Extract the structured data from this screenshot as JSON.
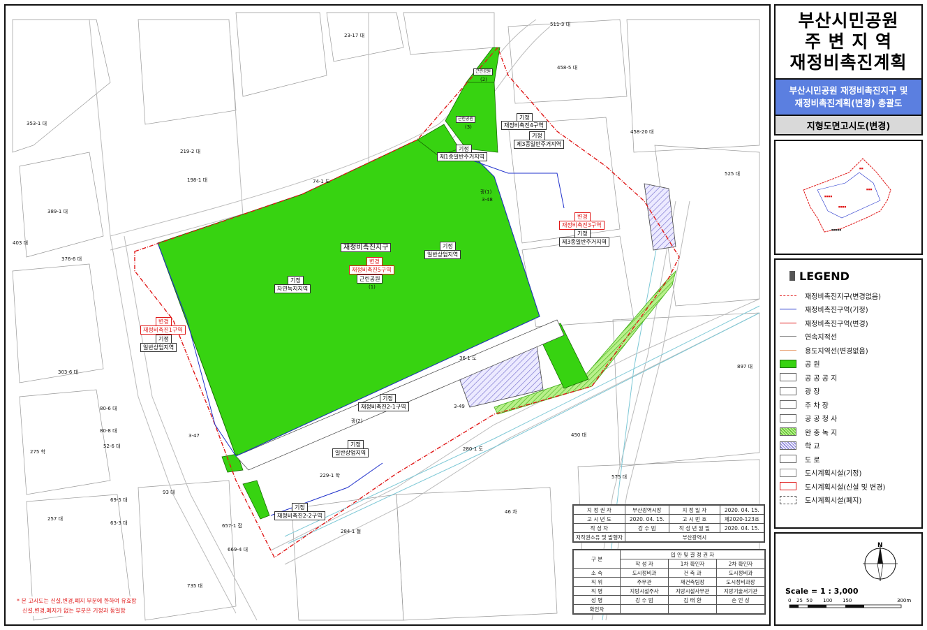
{
  "title": {
    "line1": "부산시민공원",
    "line2": "주 변 지 역",
    "line3": "재정비촉진계획"
  },
  "subtitle": {
    "line1": "부산시민공원 재정비촉진지구 및",
    "line2": "재정비촉진계획(변경) 총괄도"
  },
  "map_name": "지형도면고시도(변경)",
  "legend": {
    "title": "LEGEND",
    "items": [
      {
        "label": "재정비촉진지구(변경없음)",
        "sym": "red-dash"
      },
      {
        "label": "재정비촉진구역(기정)",
        "sym": "blue-line"
      },
      {
        "label": "재정비촉진구역(변경)",
        "sym": "red-line"
      },
      {
        "label": "연속지적선",
        "sym": "gray-line"
      },
      {
        "label": "용도지역선(변경없음)",
        "sym": "orange-line"
      },
      {
        "label": "공 원",
        "sym": "green-fill"
      },
      {
        "label": "공 공 공 지",
        "sym": "box"
      },
      {
        "label": "광 장",
        "sym": "box"
      },
      {
        "label": "주 차 장",
        "sym": "box"
      },
      {
        "label": "공 공 청 사",
        "sym": "box"
      },
      {
        "label": "완 충 녹 지",
        "sym": "hatch-green"
      },
      {
        "label": "학 교",
        "sym": "hatch-blue"
      },
      {
        "label": "도 로",
        "sym": "empty"
      },
      {
        "label": "도시계획시설(기정)",
        "sym": "gray-frame"
      },
      {
        "label": "도시계획시설(신설 및 변경)",
        "sym": "red-frame"
      },
      {
        "label": "도시계획시설(폐지)",
        "sym": "dash-frame"
      }
    ]
  },
  "scale": {
    "label": "Scale = 1 : 3,000",
    "ticks": [
      "0",
      "25",
      "50",
      "100",
      "150",
      "300m"
    ],
    "north": "N"
  },
  "map_labels": {
    "district": "재정비촉진지구",
    "change": "변경",
    "zone5": "재정비촉진5구역",
    "park": "근린공원",
    "park_no": "(1)",
    "existing": "기정",
    "natural_green": "자연녹지지역",
    "general_commercial": "일반상업지역",
    "zone4": "재정비촉진4구역",
    "residential3": "제3종일반주거지역",
    "residential1": "제1종일반주거지역",
    "zone3": "재정비촉진3구역",
    "zone1": "재정비촉진1구역",
    "zone2_1": "재정비촉진2-1구역",
    "zone2_2": "재정비촉진2-2구역",
    "park_small": "근린공원",
    "park2": "(2)",
    "park3": "(3)",
    "road1": "광(1)",
    "road2": "광(2)",
    "road3": "3-48",
    "road4": "3-49",
    "road5": "3-47",
    "parcels": [
      "23-17 대",
      "511-3 대",
      "458-5 대",
      "458-20 대",
      "525 대",
      "353-1 대",
      "219-2 대",
      "198-1 대",
      "74-1 도",
      "389-1 대",
      "403 대",
      "376-6 대",
      "303-6 대",
      "80-6 대",
      "80-8 대",
      "52-6 대",
      "275 학",
      "93 대",
      "69-5 대",
      "63-3 대",
      "257 대",
      "735 대",
      "669-4 대",
      "657-1 잡",
      "229-1 학",
      "280-1 도",
      "284-1 철",
      "46 차",
      "36-1 도",
      "450 대",
      "575 대",
      "897 대"
    ]
  },
  "info_table": {
    "rows": [
      [
        "지 정 권 자",
        "부산광역시장",
        "지 정 일 자",
        "2020. 04. 15."
      ],
      [
        "고 시 년 도",
        "2020. 04. 15.",
        "고 시 번 호",
        "제2020-123호"
      ],
      [
        "작 성 자",
        "강 수 범",
        "작 성 년 월 일",
        "2020. 04. 15."
      ],
      [
        "저작권소유 및 발행자",
        "부산광역시",
        "",
        ""
      ]
    ]
  },
  "approval_table": {
    "header": [
      "구 분",
      "입 안 및 결 정 권 자",
      "",
      ""
    ],
    "sub": [
      "",
      "작 성 자",
      "1차 확인자",
      "2차 확인자"
    ],
    "rows": [
      [
        "소 속",
        "도시정비과",
        "건 축 과",
        "도시정비과"
      ],
      [
        "직 위",
        "주무관",
        "재건축팀장",
        "도시정비과장"
      ],
      [
        "직 명",
        "지방시설주사",
        "지방시설사무관",
        "지방기술서기관"
      ],
      [
        "성 명",
        "강 수 범",
        "김 태 환",
        "손 인 상"
      ],
      [
        "확인자",
        "",
        "",
        ""
      ]
    ]
  },
  "notes": {
    "line1": "* 본 고시도는 신설,변경,폐지 부분에 한하여 유효함",
    "line2": "신설,변경,폐지가 없는 부분은 기정과 동일함"
  },
  "colors": {
    "park": "#37d311",
    "red": "#e01818",
    "blue": "#2233cc",
    "legend_header": "#5b7fe0"
  }
}
